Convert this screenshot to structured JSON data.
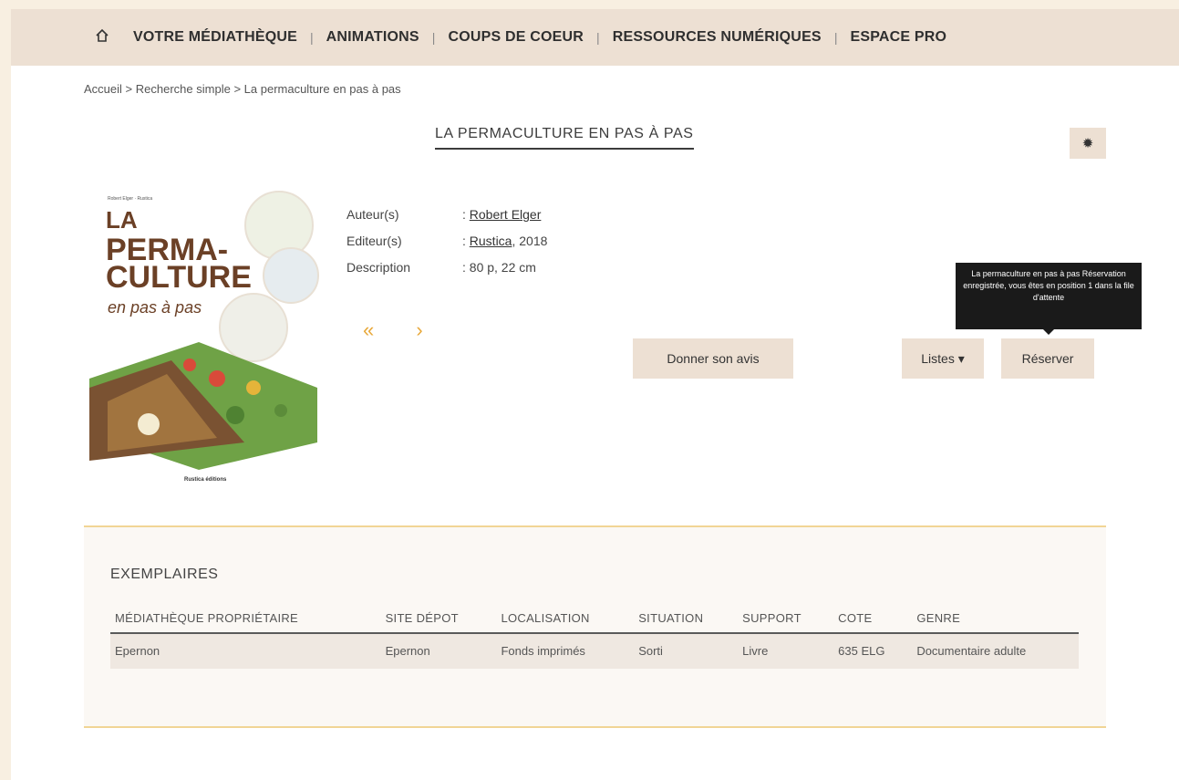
{
  "nav": {
    "home_icon": "home-icon",
    "items": [
      "VOTRE MÉDIATHÈQUE",
      "ANIMATIONS",
      "COUPS DE COEUR",
      "RESSOURCES NUMÉRIQUES",
      "ESPACE PRO"
    ],
    "separator": "|"
  },
  "breadcrumb": {
    "home": "Accueil",
    "search": "Recherche simple",
    "current": "La permaculture en pas à pas",
    "separator": ">"
  },
  "title": "LA PERMACULTURE EN PAS À PAS",
  "cover": {
    "author_small": "Robert Elger · Rustica",
    "line1": "LA",
    "line2": "PERMA-",
    "line3": "CULTURE",
    "line4": "en pas à pas",
    "publisher": "Rustica éditions"
  },
  "metadata": {
    "author_label": "Auteur(s)",
    "author_value": "Robert Elger",
    "publisher_label": "Editeur(s)",
    "publisher_value": "Rustica",
    "year": ", 2018",
    "description_label": "Description",
    "description_value": "80 p, 22 cm",
    "colon": ":"
  },
  "nav_arrows": {
    "prev": "«",
    "next": "›"
  },
  "buttons": {
    "avis": "Donner son avis",
    "listes": "Listes ▾",
    "reserver": "Réserver"
  },
  "tooltip": "La permaculture en pas à pas Réservation enregistrée, vous êtes en position 1 dans la file d'attente",
  "exemplaires": {
    "heading": "EXEMPLAIRES",
    "columns": [
      "MÉDIATHÈQUE PROPRIÉTAIRE",
      "SITE DÉPOT",
      "LOCALISATION",
      "SITUATION",
      "SUPPORT",
      "COTE",
      "GENRE"
    ],
    "rows": [
      [
        "Epernon",
        "Epernon",
        "Fonds imprimés",
        "Sorti",
        "Livre",
        "635 ELG",
        "Documentaire adulte"
      ]
    ]
  },
  "colors": {
    "nav_bg": "#ede0d3",
    "accent_line": "#f1d595",
    "arrow": "#e8a93b",
    "cover_title": "#6b4026"
  }
}
